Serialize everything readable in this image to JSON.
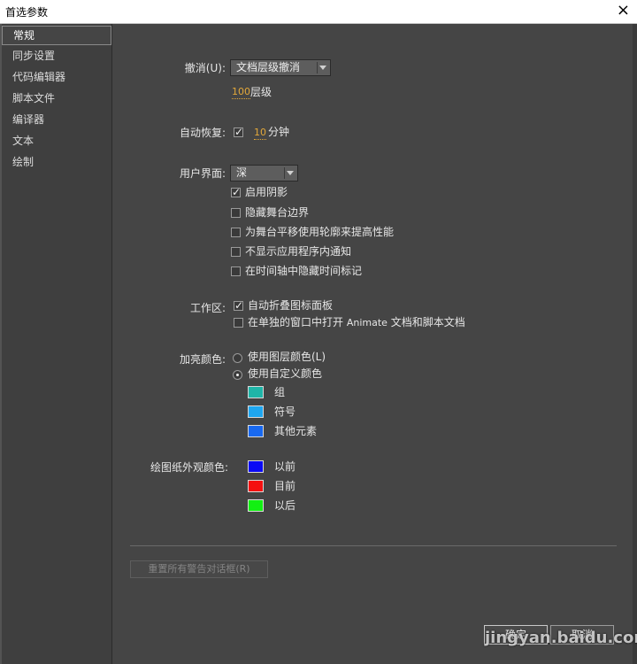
{
  "window": {
    "title": "首选参数",
    "close_icon": "×"
  },
  "sidebar": {
    "items": [
      {
        "label": "常规",
        "active": true
      },
      {
        "label": "同步设置"
      },
      {
        "label": "代码编辑器"
      },
      {
        "label": "脚本文件"
      },
      {
        "label": "编译器"
      },
      {
        "label": "文本"
      },
      {
        "label": "绘制"
      }
    ]
  },
  "undo": {
    "label": "撤消(U):",
    "value": "文档层级撤消",
    "levels": "100",
    "levels_suffix": "层级"
  },
  "autorecover": {
    "label": "自动恢复:",
    "checked": true,
    "minutes": "10",
    "minutes_suffix": "分钟"
  },
  "ui": {
    "label": "用户界面:",
    "value": "深",
    "options": [
      {
        "label": "启用阴影",
        "checked": true
      },
      {
        "label": "隐藏舞台边界",
        "checked": false
      },
      {
        "label": "为舞台平移使用轮廓来提高性能",
        "checked": false
      },
      {
        "label": "不显示应用程序内通知",
        "checked": false
      },
      {
        "label": "在时间轴中隐藏时间标记",
        "checked": false
      }
    ]
  },
  "workspace": {
    "label": "工作区:",
    "options": [
      {
        "label": "自动折叠图标面板",
        "checked": true
      },
      {
        "label": "在单独的窗口中打开",
        "label_latin": "Animate",
        "label_tail": "文档和脚本文档",
        "checked": false
      }
    ]
  },
  "highlight": {
    "label": "加亮颜色:",
    "radio_layer": "使用图层颜色(L)",
    "radio_custom": "使用自定义颜色",
    "swatches": [
      {
        "label": "组",
        "color": "#1fb5a8"
      },
      {
        "label": "符号",
        "color": "#1ea6f0"
      },
      {
        "label": "其他元素",
        "color": "#1869f0"
      }
    ]
  },
  "pasteboard": {
    "label": "绘图纸外观颜色:",
    "swatches": [
      {
        "label": "以前",
        "color": "#0a0af5"
      },
      {
        "label": "目前",
        "color": "#f51010"
      },
      {
        "label": "以后",
        "color": "#12f012"
      }
    ]
  },
  "reset_label": "重置所有警告对话框(R)",
  "buttons": {
    "ok": "确定",
    "cancel": "取消"
  },
  "watermark": "jingyan.baidu.com"
}
